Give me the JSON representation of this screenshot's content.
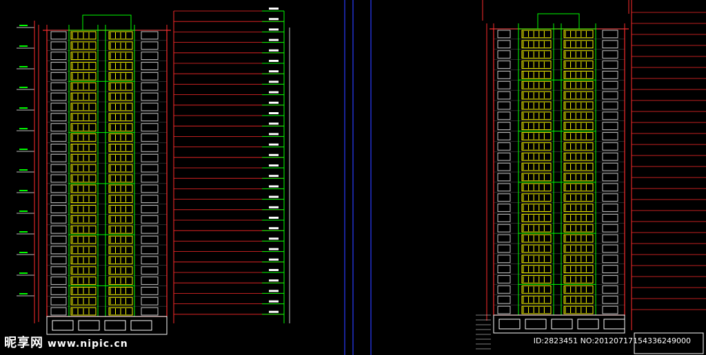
{
  "watermark": {
    "brand": "昵享网",
    "url": "www.nipic.cn",
    "id_line": "ID:2823451 NO:20120717154336249000"
  },
  "colors": {
    "background": "#000000",
    "window": "#ffff00",
    "grid": "#00ff00",
    "outline": "#ff2b2b",
    "annotation": "#ffffff",
    "column": "#2a3cff"
  },
  "drawing": {
    "left_building": {
      "name": "left-tower-elevation",
      "floors": 28
    },
    "right_building": {
      "name": "right-tower-elevation",
      "floors": 28
    }
  }
}
